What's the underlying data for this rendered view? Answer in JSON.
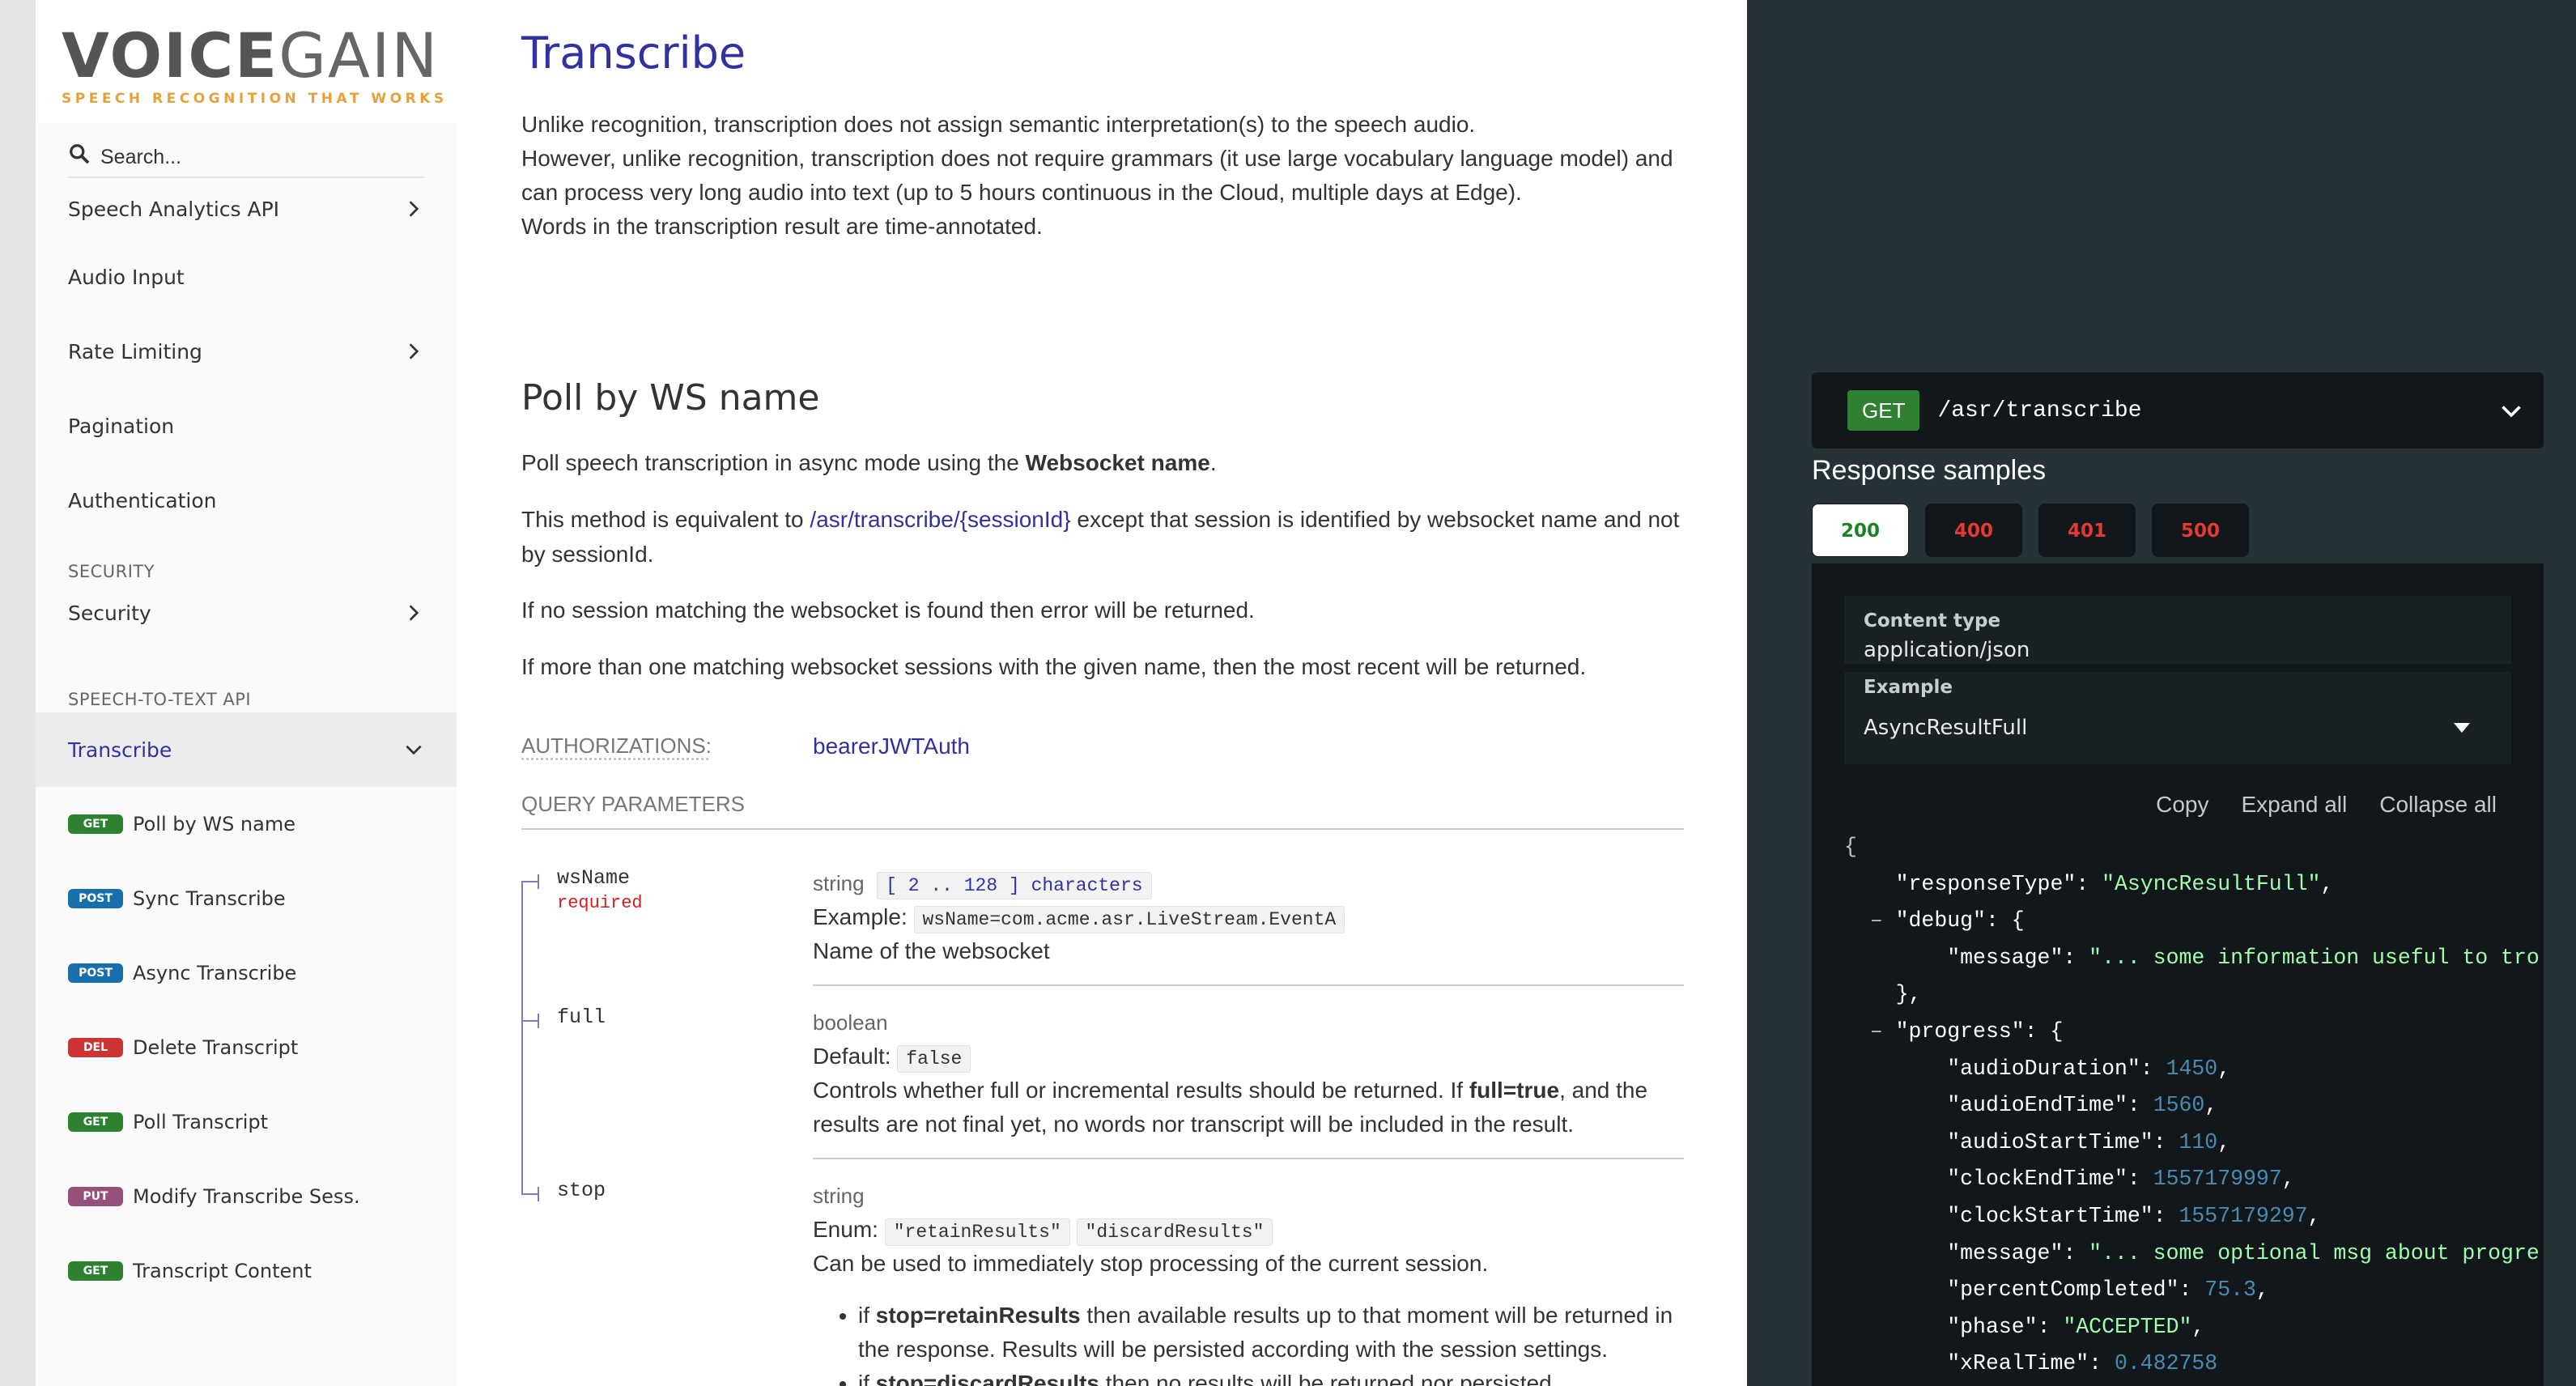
{
  "sidebar": {
    "logo": {
      "voice": "VOICE",
      "gain": "GAIN",
      "tagline": "SPEECH RECOGNITION THAT WORKS"
    },
    "search_placeholder": "Search...",
    "items": [
      {
        "label": "Speech Analytics API"
      },
      {
        "label": "Audio Input"
      },
      {
        "label": "Rate Limiting"
      },
      {
        "label": "Pagination"
      },
      {
        "label": "Authentication"
      }
    ],
    "section_security": "SECURITY",
    "security_item": "Security",
    "section_stt": "SPEECH-TO-TEXT API",
    "transcribe_item": "Transcribe",
    "operations": [
      {
        "method": "GET",
        "label": "Poll by WS name",
        "color": "#2f8132"
      },
      {
        "method": "POST",
        "label": "Sync Transcribe",
        "color": "#186fab"
      },
      {
        "method": "POST",
        "label": "Async Transcribe",
        "color": "#186fab"
      },
      {
        "method": "DEL",
        "label": "Delete Transcript",
        "color": "#cc3333"
      },
      {
        "method": "GET",
        "label": "Poll Transcript",
        "color": "#2f8132"
      },
      {
        "method": "PUT",
        "label": "Modify Transcribe Sess.",
        "color": "#95507c"
      },
      {
        "method": "GET",
        "label": "Transcript Content",
        "color": "#2f8132"
      }
    ]
  },
  "main": {
    "title": "Transcribe",
    "intro": [
      "Unlike recognition, transcription does not assign semantic interpretation(s) to the speech audio.",
      "However, unlike recognition, transcription does not require grammars (it use large vocabulary language model) and can process very long audio into text (up to 5 hours continuous in the Cloud, multiple days at Edge).",
      "Words in the transcription result are time-annotated."
    ],
    "op_title": "Poll by WS name",
    "p1_pre": "Poll speech transcription in async mode using the ",
    "p1_bold": "Websocket name",
    "p1_post": ".",
    "p2_pre": "This method is equivalent to ",
    "p2_link": "/asr/transcribe/{sessionId}",
    "p2_post": " except that session is identified by websocket name and not by sessionId.",
    "p3": "If no session matching the websocket is found then error will be returned.",
    "p4": "If more than one matching websocket sessions with the given name, then the most recent will be returned.",
    "auth_label": "AUTHORIZATIONS:",
    "auth_value": "bearerJWTAuth",
    "query_header": "QUERY PARAMETERS",
    "params": {
      "wsName": {
        "name": "wsName",
        "required": "required",
        "type": "string",
        "constraint": "[ 2 .. 128 ] characters",
        "example_label": "Example:",
        "example": "wsName=com.acme.asr.LiveStream.EventA",
        "desc": "Name of the websocket"
      },
      "full": {
        "name": "full",
        "type": "boolean",
        "default_label": "Default:",
        "default": "false",
        "desc_pre": "Controls whether full or incremental results should be returned. If ",
        "desc_bold": "full=true",
        "desc_post": ", and the results are not final yet, no words nor transcript will be included in the result."
      },
      "stop": {
        "name": "stop",
        "type": "string",
        "enum_label": "Enum:",
        "enum": [
          "\"retainResults\"",
          "\"discardResults\""
        ],
        "desc": "Can be used to immediately stop processing of the current session.",
        "bullet1_pre": "if ",
        "bullet1_bold": "stop=retainResults",
        "bullet1_post": " then available results up to that moment will be returned in the response. Results will be persisted according with the session settings.",
        "bullet2_pre": "if ",
        "bullet2_bold": "stop=discardResults",
        "bullet2_post": " then no results will be returned nor persisted."
      }
    }
  },
  "right": {
    "verb": "GET",
    "path": "/asr/transcribe",
    "response_title": "Response samples",
    "status_codes": [
      "200",
      "400",
      "401",
      "500"
    ],
    "content_type_label": "Content type",
    "content_type": "application/json",
    "example_label": "Example",
    "example_value": "AsyncResultFull",
    "tools": {
      "copy": "Copy",
      "expand": "Expand all",
      "collapse": "Collapse all"
    },
    "json": {
      "responseType": "\"AsyncResultFull\"",
      "debug_message": "\"... some information useful to tro",
      "audioDuration": "1450",
      "audioEndTime": "1560",
      "audioStartTime": "110",
      "clockEndTime": "1557179997",
      "clockStartTime": "1557179297",
      "progress_message": "\"... some optional msg about progre",
      "percentCompleted": "75.3",
      "phase": "\"ACCEPTED\"",
      "xRealTime": "0.482758"
    }
  }
}
